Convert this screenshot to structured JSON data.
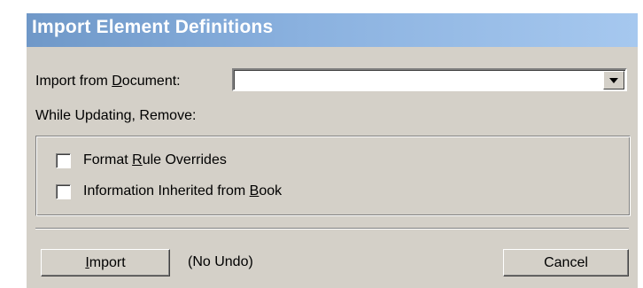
{
  "dialog": {
    "title": "Import Element Definitions"
  },
  "import_from": {
    "label_pre": "Import from ",
    "label_mnemonic": "D",
    "label_post": "ocument:",
    "value": ""
  },
  "while_updating": {
    "label": "While Updating, Remove:"
  },
  "options": [
    {
      "pre": "Format ",
      "mnemonic": "R",
      "post": "ule Overrides",
      "checked": false
    },
    {
      "pre": "Information Inherited from ",
      "mnemonic": "B",
      "post": "ook",
      "checked": false
    }
  ],
  "buttons": {
    "import_mnemonic": "I",
    "import_rest": "mport",
    "no_undo_note": "(No Undo)",
    "cancel": "Cancel"
  }
}
